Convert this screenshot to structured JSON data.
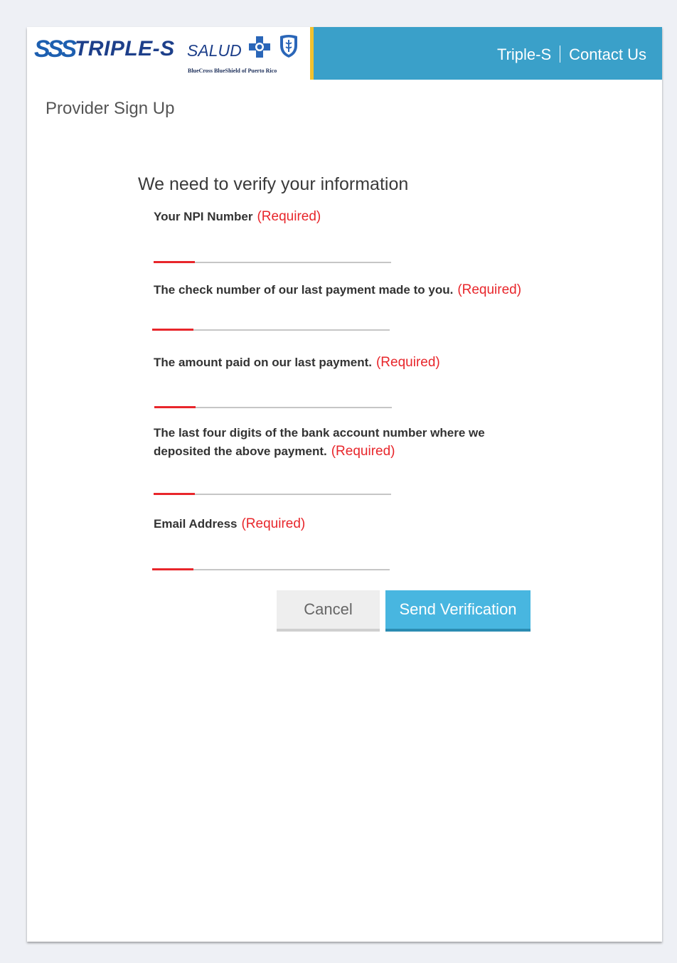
{
  "brand": {
    "mark": "SSS",
    "name": "TRIPLE-S",
    "sub": "SALUD",
    "tagline": "BlueCross BlueShield of Puerto Rico"
  },
  "nav": {
    "link1": "Triple-S",
    "link2": "Contact Us"
  },
  "page_title": "Provider Sign Up",
  "form": {
    "heading": "We need to verify your information",
    "required_text": "(Required)",
    "fields": [
      {
        "label": "Your NPI Number",
        "value": ""
      },
      {
        "label": "The check number of our last payment made to you.",
        "value": ""
      },
      {
        "label": "The amount paid on our last payment.",
        "value": ""
      },
      {
        "label": "The last four digits of the bank account number where we deposited the above payment.",
        "value": ""
      },
      {
        "label": "Email Address",
        "value": ""
      }
    ]
  },
  "buttons": {
    "cancel": "Cancel",
    "send": "Send Verification"
  },
  "colors": {
    "header_blue": "#3aa0c9",
    "accent_yellow": "#f2c12e",
    "required_red": "#e8262b",
    "send_button": "#48b6e0"
  }
}
